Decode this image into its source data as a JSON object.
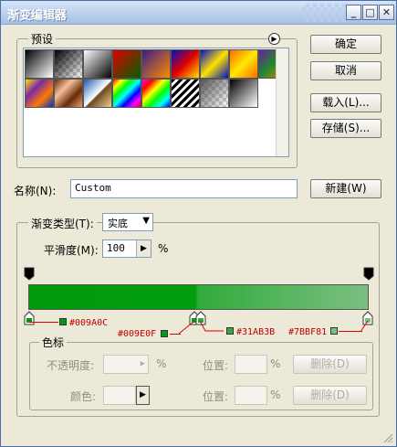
{
  "title": "渐变编辑器",
  "window_controls": {
    "help": "?",
    "minimize": "_",
    "maximize": "□",
    "close": "✕"
  },
  "buttons": {
    "ok": "确定",
    "cancel": "取消",
    "load": "载入(L)...",
    "save": "存储(S)...",
    "new": "新建(W)",
    "delete": "删除(D)"
  },
  "presets": {
    "label": "预设",
    "swatches": [
      {
        "name": "foreground-to-background",
        "css": "linear-gradient(135deg,#000,#fff)"
      },
      {
        "name": "foreground-to-transparent",
        "css": "linear-gradient(135deg,#000 0%,rgba(0,0,0,0) 100%)"
      },
      {
        "name": "black-white",
        "css": "linear-gradient(135deg,#fff,#000)"
      },
      {
        "name": "red-green",
        "css": "linear-gradient(135deg,#e00000,#006000)"
      },
      {
        "name": "violet-orange",
        "css": "linear-gradient(135deg,#3a1c8a,#ff8a00)"
      },
      {
        "name": "blue-red-yellow",
        "css": "linear-gradient(135deg,#0010c8,#e00000,#ffe000)"
      },
      {
        "name": "blue-yellow-blue",
        "css": "linear-gradient(135deg,#0010c8,#ffe000,#0010c8)"
      },
      {
        "name": "orange-yellow-orange",
        "css": "linear-gradient(135deg,#ff6a00,#ffe800,#ff6a00)"
      },
      {
        "name": "violet-green-orange",
        "css": "linear-gradient(135deg,#6b1d9e,#1e8b2a,#ff7a00)"
      },
      {
        "name": "yellow-violet-orange-blue",
        "css": "linear-gradient(135deg,#ffe000,#7a2aa6,#ff7a00,#0030c0)"
      },
      {
        "name": "copper",
        "css": "linear-gradient(135deg,#6a2a0a,#f4c19a,#6a2a0a,#e8a070)"
      },
      {
        "name": "chrome",
        "css": "linear-gradient(135deg,#1a5ab0,#fff 50%,#6a4a20 55%,#f0d090)"
      },
      {
        "name": "spectrum",
        "css": "linear-gradient(135deg,#f00,#ff0,#0f0,#0ff,#00f,#f0f,#f00)"
      },
      {
        "name": "transparent-rainbow",
        "css": "linear-gradient(135deg,#f0f,#f00,#ff0,#0f0,#0ff,#00f)"
      },
      {
        "name": "transparent-stripes",
        "css": "repeating-linear-gradient(135deg,#000 0 3px,#fff 3px 6px)"
      },
      {
        "name": "neutral-density",
        "css": "linear-gradient(135deg,#555,rgba(255,255,255,0))"
      },
      {
        "name": "custom",
        "css": "linear-gradient(135deg,#000,#fff)"
      }
    ]
  },
  "name": {
    "label": "名称(N):",
    "value": "Custom"
  },
  "gradient_type": {
    "label": "渐变类型(T):",
    "value": "实底"
  },
  "smoothness": {
    "label": "平滑度(M):",
    "value": "100",
    "unit": "%"
  },
  "gradient": {
    "stops": [
      {
        "position": 0,
        "color": "#009A0C"
      },
      {
        "position": 49,
        "color": "#009E0F"
      },
      {
        "position": 50,
        "color": "#31AB3B"
      },
      {
        "position": 100,
        "color": "#7BBF81"
      }
    ],
    "opacity_stops": [
      {
        "position": 0
      },
      {
        "position": 100
      }
    ],
    "labels": [
      "#009A0C",
      "#009E0F",
      "#31AB3B",
      "#7BBF81"
    ]
  },
  "color_stops": {
    "label": "色标",
    "opacity_label": "不透明度:",
    "opacity_unit": "%",
    "color_label": "颜色:",
    "location_label": "位置:",
    "location_unit": "%"
  }
}
